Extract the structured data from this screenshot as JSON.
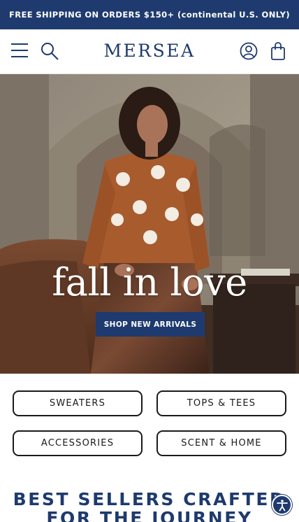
{
  "promo": {
    "text": "FREE SHIPPING ON ORDERS $150+ (continental U.S. ONLY)"
  },
  "header": {
    "logo": "MERSEA",
    "icons": [
      "menu-icon",
      "search-icon",
      "account-icon",
      "cart-icon"
    ]
  },
  "hero": {
    "title": "fall in love",
    "cta_label": "SHOP NEW ARRIVALS"
  },
  "categories": [
    {
      "label": "SWEATERS"
    },
    {
      "label": "TOPS & TEES"
    },
    {
      "label": "ACCESSORIES"
    },
    {
      "label": "SCENT & HOME"
    }
  ],
  "section": {
    "title_line1": "BEST SELLERS CRAFTED",
    "title_line2": "FOR THE JOURNEY"
  },
  "colors": {
    "brand_navy": "#1e3a6e",
    "white": "#ffffff",
    "outline": "#1a1a1a"
  },
  "accessibility": {
    "icon": "accessibility-icon"
  }
}
